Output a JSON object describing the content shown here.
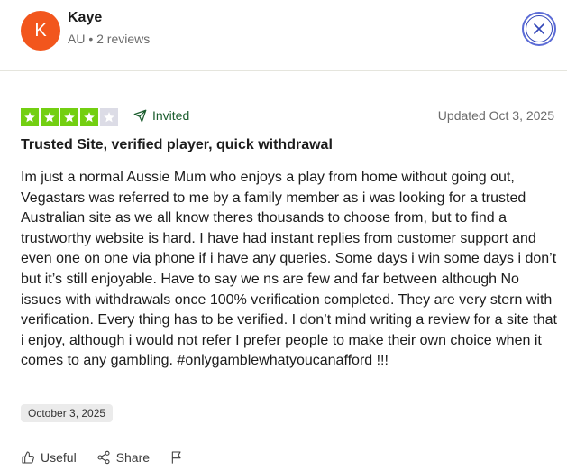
{
  "reviewer": {
    "initial": "K",
    "name": "Kaye",
    "meta": "AU • 2 reviews",
    "avatar_color": "#f2561d"
  },
  "review": {
    "rating": 4,
    "max_rating": 5,
    "invited_label": "Invited",
    "updated": "Updated Oct 3, 2025",
    "title": "Trusted Site, verified player, quick withdrawal",
    "body": "Im just a normal Aussie Mum who enjoys a play from home without going out, Vegastars was referred to me by a family member as i was looking for a trusted Australian site as we all know theres thousands to choose from, but to find a trustworthy website is hard. I have had instant replies from customer support and even one on one via phone if i have any queries. Some days i win some days i don’t but it’s still enjoyable. Have to say we ns are few and far between although No issues with withdrawals once 100% verification completed. They are very stern with verification. Every thing has to be verified. I don’t mind writing a review for a site that i enjoy, although i would not refer I prefer people to make their own choice when it comes to any gambling. #onlygamblewhatyoucanafford !!!",
    "date_of_experience": "October 3, 2025",
    "star_color": "#73cf11"
  },
  "actions": {
    "useful_label": "Useful",
    "share_label": "Share"
  },
  "icons": {
    "close": "close-icon",
    "invited": "paper-plane-icon",
    "useful": "thumbs-up-icon",
    "share": "share-icon",
    "report": "flag-icon"
  }
}
